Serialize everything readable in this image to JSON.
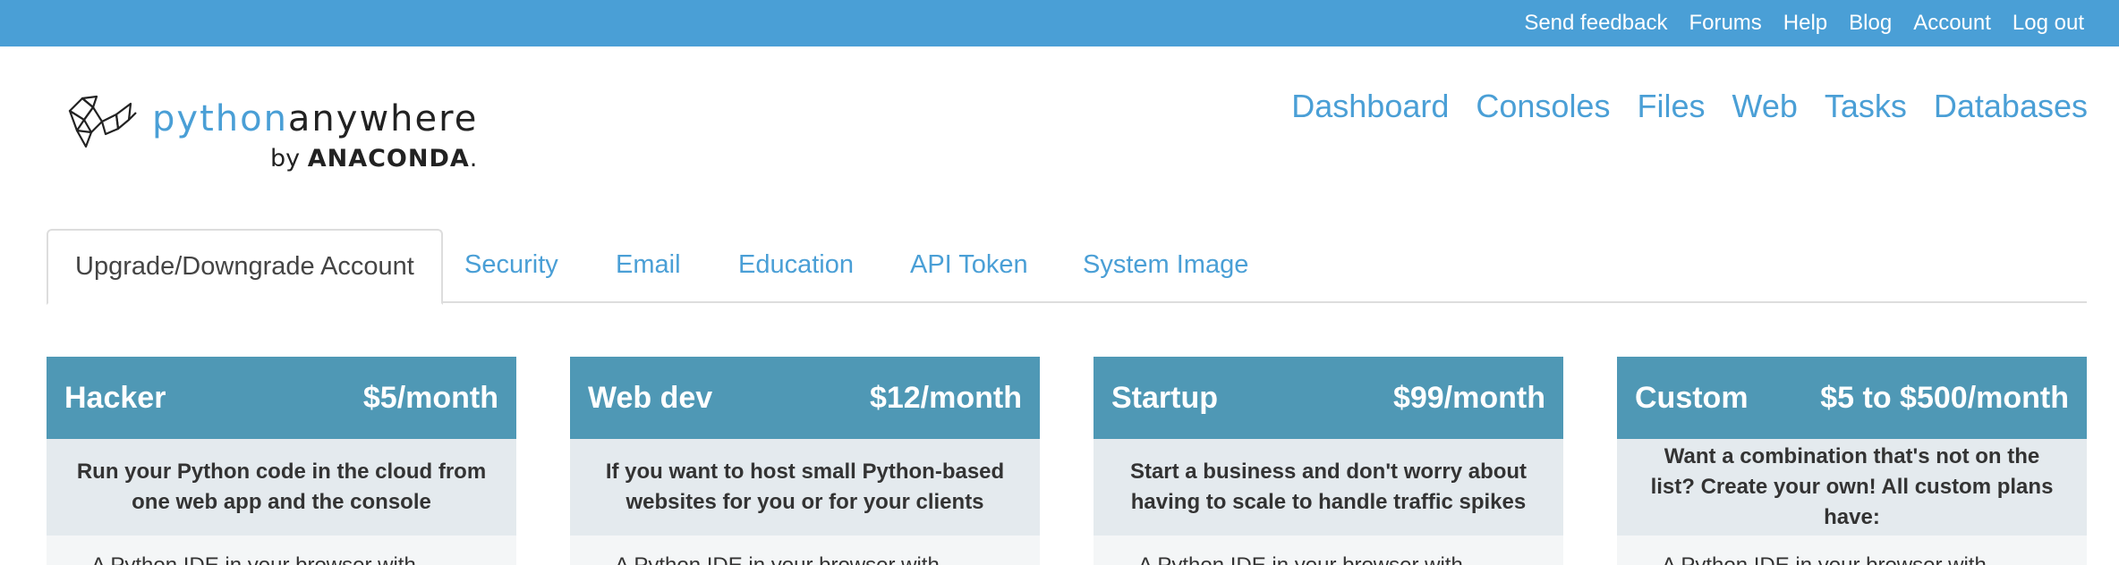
{
  "topbar": {
    "links": [
      "Send feedback",
      "Forums",
      "Help",
      "Blog",
      "Account",
      "Log out"
    ]
  },
  "logo": {
    "python": "python",
    "anywhere": "anywhere",
    "by": "by",
    "brand": "ANACONDA",
    "brand_dot": "."
  },
  "nav": {
    "items": [
      "Dashboard",
      "Consoles",
      "Files",
      "Web",
      "Tasks",
      "Databases"
    ]
  },
  "tabs": {
    "items": [
      "Upgrade/Downgrade Account",
      "Security",
      "Email",
      "Education",
      "API Token",
      "System Image"
    ],
    "active": "Upgrade/Downgrade Account"
  },
  "plans": [
    {
      "name": "Hacker",
      "price": "$5/month",
      "description": "Run your Python code in the cloud from one web app and the console",
      "feature": "A Python IDE in your browser with"
    },
    {
      "name": "Web dev",
      "price": "$12/month",
      "description": "If you want to host small Python-based websites for you or for your clients",
      "feature": "A Python IDE in your browser with"
    },
    {
      "name": "Startup",
      "price": "$99/month",
      "description": "Start a business and don't worry about having to scale to handle traffic spikes",
      "feature": "A Python IDE in your browser with"
    },
    {
      "name": "Custom",
      "price": "$5 to $500/month",
      "description": "Want a combination that's not on the list? Create your own! All custom plans have:",
      "feature": "A Python IDE in your browser with"
    }
  ],
  "colors": {
    "topbar": "#4a9fd6",
    "link": "#4a9fd6",
    "plan_header": "#4f98b5",
    "plan_desc_bg": "#e4eaee"
  }
}
